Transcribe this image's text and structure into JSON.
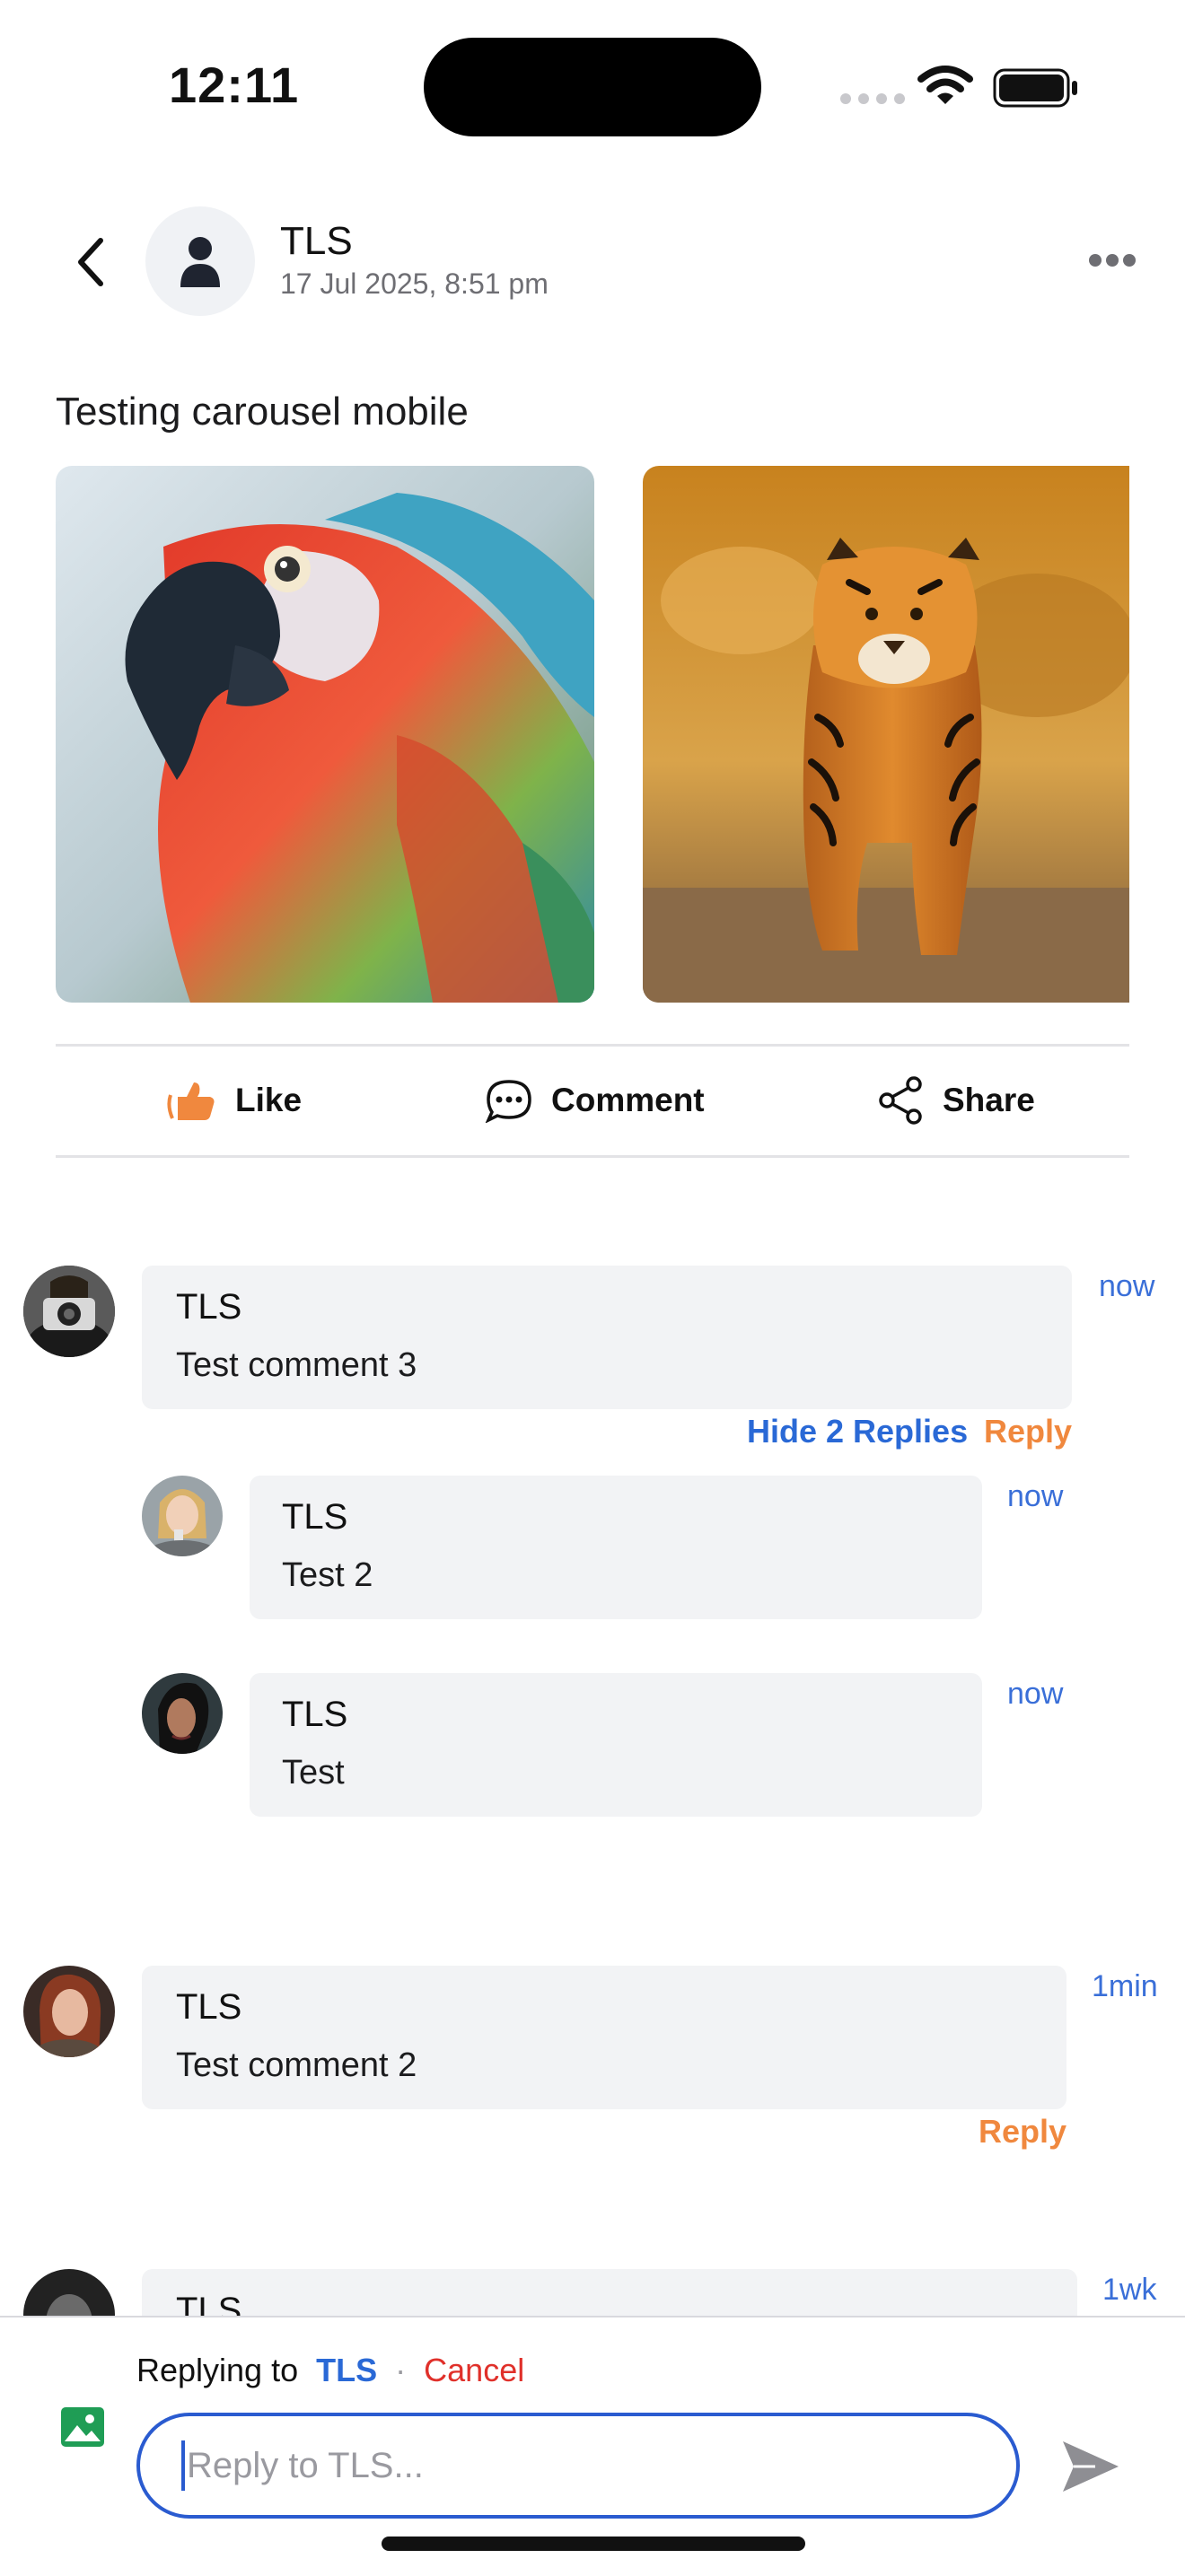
{
  "status_bar": {
    "time": "12:11"
  },
  "header": {
    "author": "TLS",
    "date": "17 Jul 2025, 8:51 pm"
  },
  "post": {
    "text": "Testing carousel mobile",
    "images": [
      "parrot",
      "tiger"
    ]
  },
  "actions": {
    "like_label": "Like",
    "comment_label": "Comment",
    "share_label": "Share"
  },
  "comments": [
    {
      "author": "TLS",
      "text": "Test comment 3",
      "time": "now",
      "hide_replies_label": "Hide 2 Replies",
      "reply_label": "Reply",
      "replies": [
        {
          "author": "TLS",
          "text": "Test 2",
          "time": "now"
        },
        {
          "author": "TLS",
          "text": "Test",
          "time": "now"
        }
      ]
    },
    {
      "author": "TLS",
      "text": "Test comment 2",
      "time": "1min",
      "reply_label": "Reply"
    },
    {
      "author": "TLS",
      "text": "",
      "time": "1wk"
    }
  ],
  "composer": {
    "replying_prefix": "Replying to",
    "replying_target": "TLS",
    "separator": "·",
    "cancel_label": "Cancel",
    "placeholder": "Reply to TLS..."
  },
  "colors": {
    "accent_blue": "#2a69d6",
    "accent_orange": "#f0883e",
    "cancel_red": "#e0302a",
    "bubble_bg": "#f2f3f5"
  },
  "icons": [
    "back-chevron-icon",
    "user-icon",
    "more-icon",
    "like-icon",
    "comment-icon",
    "share-icon",
    "image-icon",
    "send-icon",
    "wifi-icon",
    "battery-icon"
  ]
}
